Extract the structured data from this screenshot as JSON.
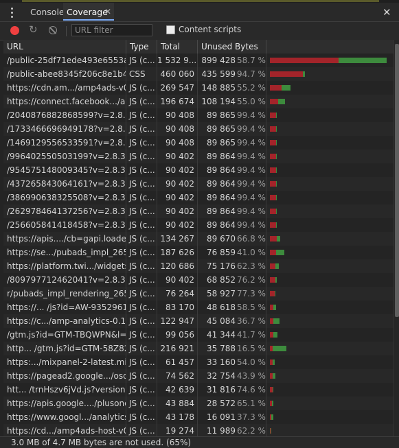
{
  "tabs": {
    "console": "Console",
    "coverage": "Coverage",
    "tab_close": "✕",
    "panel_close": "✕"
  },
  "toolbar": {
    "url_filter_placeholder": "URL filter",
    "content_scripts_label": "Content scripts",
    "record_color": "#ef4040"
  },
  "columns": {
    "url": "URL",
    "type": "Type",
    "total": "Total By...",
    "unused": "Unused Bytes"
  },
  "colors": {
    "used": "#a3242a",
    "unused": "#3d8b3d"
  },
  "rows": [
    {
      "url": "/public-25df71ede493e6553a8a",
      "type": "JS (c...",
      "total": "1 532 9...",
      "unused": "899 428",
      "pct": "58.7 %",
      "total_kb": 1532.9,
      "used_frac": 0.413
    },
    {
      "url": "/public-abee8345f206c8e1b4bc!",
      "type": "CSS",
      "total": "460 060",
      "unused": "435 599",
      "pct": "94.7 %",
      "total_kb": 460.06,
      "used_frac": 0.053
    },
    {
      "url": "https://cdn.am.../amp4ads-v0.js",
      "type": "JS (c...",
      "total": "269 547",
      "unused": "148 885",
      "pct": "55.2 %",
      "total_kb": 269.547,
      "used_frac": 0.448
    },
    {
      "url": "https://connect.facebook.../all.js",
      "type": "JS (c...",
      "total": "196 674",
      "unused": "108 194",
      "pct": "55.0 %",
      "total_kb": 196.674,
      "used_frac": 0.45
    },
    {
      "url": "/2040876882868599?v=2.8.30&",
      "type": "JS (c...",
      "total": "90 408",
      "unused": "89 865",
      "pct": "99.4 %",
      "total_kb": 90.408,
      "used_frac": 0.006
    },
    {
      "url": "/1733466696949178?v=2.8.30&",
      "type": "JS (c...",
      "total": "90 408",
      "unused": "89 865",
      "pct": "99.4 %",
      "total_kb": 90.408,
      "used_frac": 0.006
    },
    {
      "url": "/1469129556533591?v=2.8.30&",
      "type": "JS (c...",
      "total": "90 408",
      "unused": "89 865",
      "pct": "99.4 %",
      "total_kb": 90.408,
      "used_frac": 0.006
    },
    {
      "url": "/996402550503199?v=2.8.30&r:",
      "type": "JS (c...",
      "total": "90 402",
      "unused": "89 864",
      "pct": "99.4 %",
      "total_kb": 90.402,
      "used_frac": 0.006
    },
    {
      "url": "/954575148009345?v=2.8.30&r:",
      "type": "JS (c...",
      "total": "90 402",
      "unused": "89 864",
      "pct": "99.4 %",
      "total_kb": 90.402,
      "used_frac": 0.006
    },
    {
      "url": "/437265843064161?v=2.8.30&r:",
      "type": "JS (c...",
      "total": "90 402",
      "unused": "89 864",
      "pct": "99.4 %",
      "total_kb": 90.402,
      "used_frac": 0.006
    },
    {
      "url": "/386990638325508?v=2.8.30&r:",
      "type": "JS (c...",
      "total": "90 402",
      "unused": "89 864",
      "pct": "99.4 %",
      "total_kb": 90.402,
      "used_frac": 0.006
    },
    {
      "url": "/262978464137256?v=2.8.30&r:",
      "type": "JS (c...",
      "total": "90 402",
      "unused": "89 864",
      "pct": "99.4 %",
      "total_kb": 90.402,
      "used_frac": 0.006
    },
    {
      "url": "/256605841418458?v=2.8.30&r:",
      "type": "JS (c...",
      "total": "90 402",
      "unused": "89 864",
      "pct": "99.4 %",
      "total_kb": 90.402,
      "used_frac": 0.006
    },
    {
      "url": "https://apis..../cb=gapi.loaded_0",
      "type": "JS (c...",
      "total": "134 267",
      "unused": "89 670",
      "pct": "66.8 %",
      "total_kb": 134.267,
      "used_frac": 0.332
    },
    {
      "url": "https://se.../pubads_impl_265.js",
      "type": "JS (c...",
      "total": "187 626",
      "unused": "76 859",
      "pct": "41.0 %",
      "total_kb": 187.626,
      "used_frac": 0.59
    },
    {
      "url": "https://platform.twi.../widgets.js",
      "type": "JS (c...",
      "total": "120 686",
      "unused": "75 176",
      "pct": "62.3 %",
      "total_kb": 120.686,
      "used_frac": 0.377
    },
    {
      "url": "/809797712462041?v=2.8.30&r:",
      "type": "JS (c...",
      "total": "90 402",
      "unused": "68 852",
      "pct": "76.2 %",
      "total_kb": 90.402,
      "used_frac": 0.238
    },
    {
      "url": "r/pubads_impl_rendering_265.js",
      "type": "JS (c...",
      "total": "76 264",
      "unused": "58 927",
      "pct": "77.3 %",
      "total_kb": 76.264,
      "used_frac": 0.227
    },
    {
      "url": "https://... /js?id=AW-935296116",
      "type": "JS (c...",
      "total": "83 170",
      "unused": "48 618",
      "pct": "58.5 %",
      "total_kb": 83.17,
      "used_frac": 0.415
    },
    {
      "url": "https://c.../amp-analytics-0.1.js",
      "type": "JS (c...",
      "total": "122 947",
      "unused": "45 084",
      "pct": "36.7 %",
      "total_kb": 122.947,
      "used_frac": 0.633
    },
    {
      "url": "/gtm.js?id=GTM-TBQWPN&l=g!",
      "type": "JS (c...",
      "total": "99 056",
      "unused": "41 344",
      "pct": "41.7 %",
      "total_kb": 99.056,
      "used_frac": 0.583
    },
    {
      "url": "http... /gtm.js?id=GTM-58Z82M",
      "type": "JS (c...",
      "total": "216 921",
      "unused": "35 788",
      "pct": "16.5 %",
      "total_kb": 216.921,
      "used_frac": 0.835
    },
    {
      "url": "https:.../mixpanel-2-latest.min.js",
      "type": "JS (c...",
      "total": "61 457",
      "unused": "33 160",
      "pct": "54.0 %",
      "total_kb": 61.457,
      "used_frac": 0.46
    },
    {
      "url": "https://pagead2.google.../osd.js",
      "type": "JS (c...",
      "total": "74 562",
      "unused": "32 754",
      "pct": "43.9 %",
      "total_kb": 74.562,
      "used_frac": 0.561
    },
    {
      "url": "htt... /trnHszv6jVd.js?version=42",
      "type": "JS (c...",
      "total": "42 639",
      "unused": "31 816",
      "pct": "74.6 %",
      "total_kb": 42.639,
      "used_frac": 0.254
    },
    {
      "url": "https://apis.google..../plusone.js",
      "type": "JS (c...",
      "total": "43 884",
      "unused": "28 572",
      "pct": "65.1 %",
      "total_kb": 43.884,
      "used_frac": 0.349
    },
    {
      "url": "https://www.googl.../analytics.js",
      "type": "JS (c...",
      "total": "43 178",
      "unused": "16 091",
      "pct": "37.3 %",
      "total_kb": 43.178,
      "used_frac": 0.627
    },
    {
      "url": "https://cd.../amp4ads-host-v0.js",
      "type": "JS (c...",
      "total": "19 274",
      "unused": "11 989",
      "pct": "62.2 %",
      "total_kb": 19.274,
      "used_frac": 0.378
    }
  ],
  "footer": {
    "summary": "3.0 MB of 4.7 MB bytes are not used. (65%)"
  }
}
